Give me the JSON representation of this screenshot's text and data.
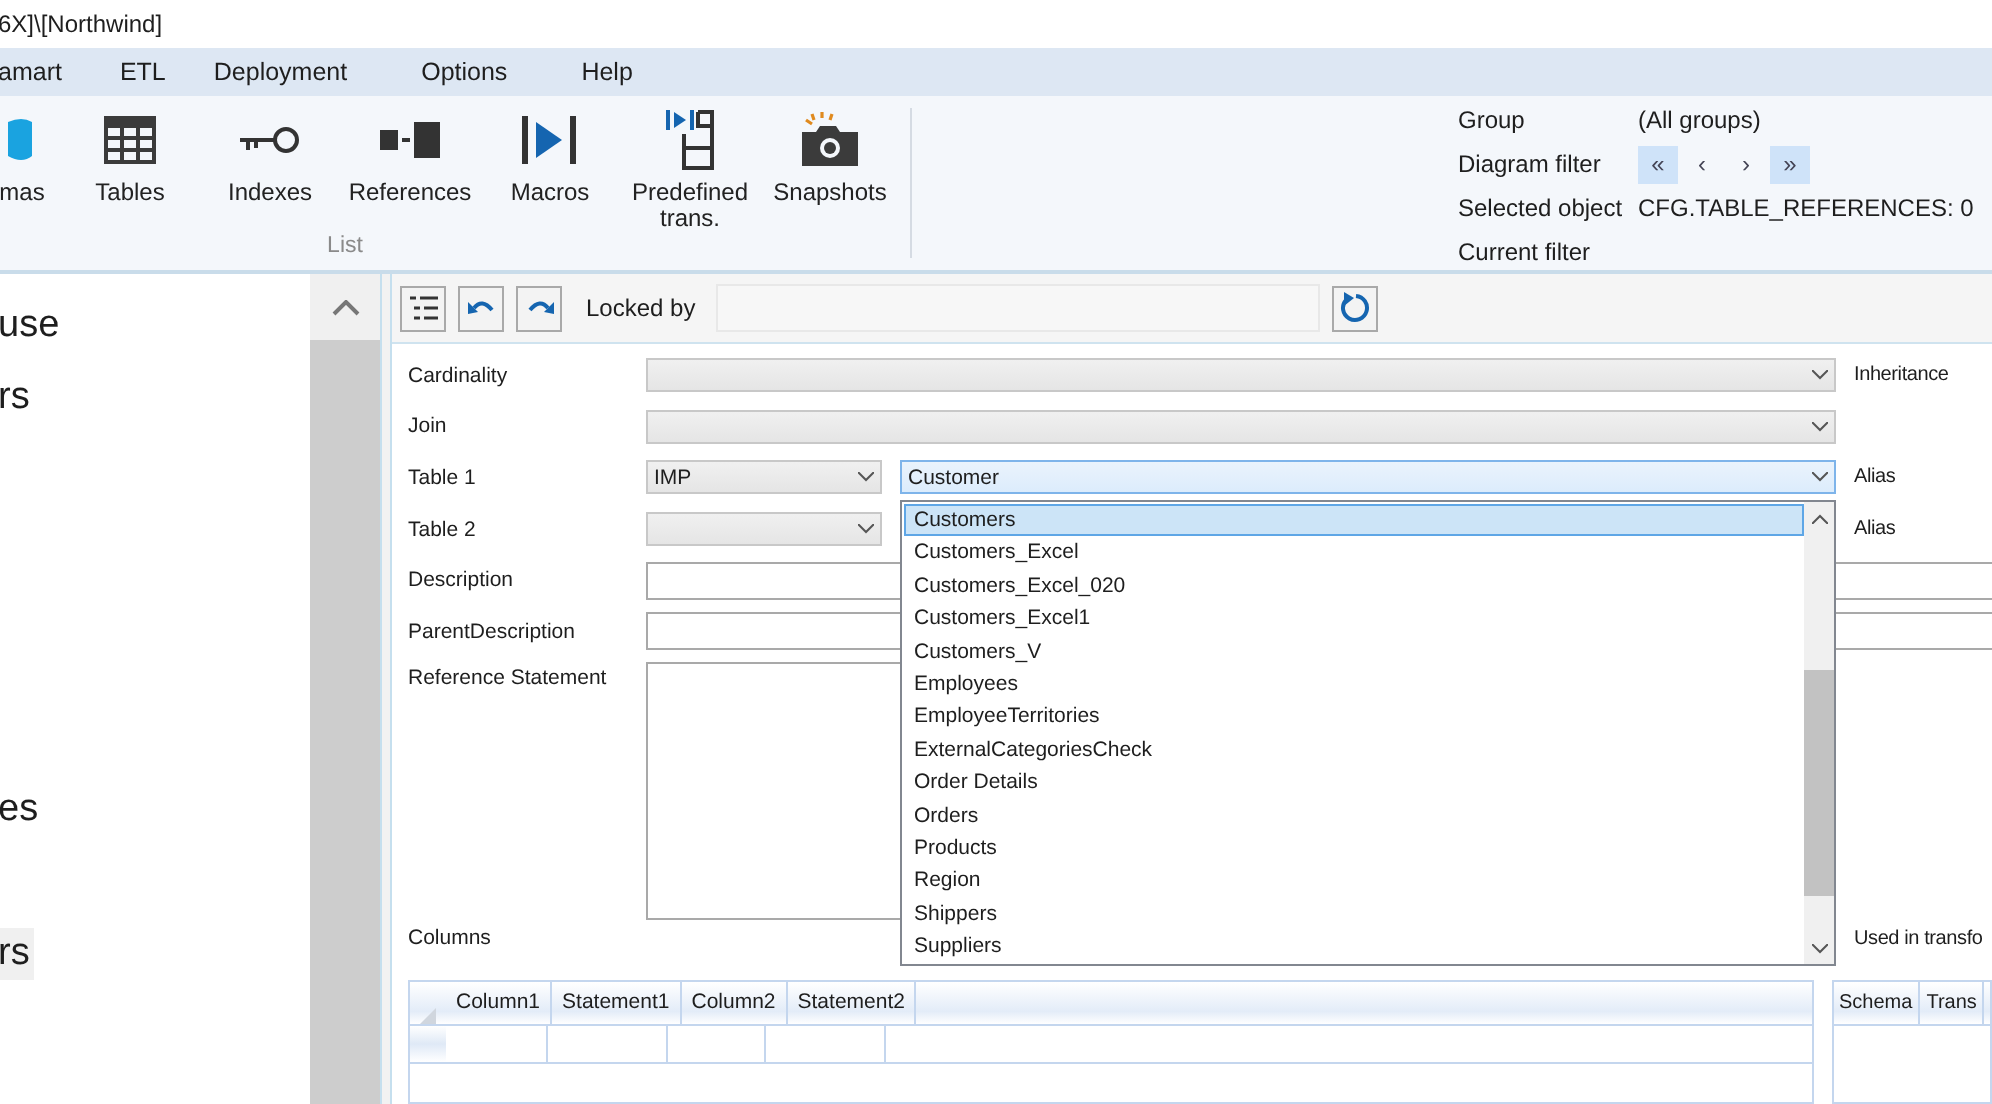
{
  "title": "6X]\\[Northwind]",
  "menu": [
    "amart",
    "ETL",
    "Deployment",
    "Options",
    "Help"
  ],
  "ribbon": {
    "buttons": [
      {
        "kind": "schemas",
        "label": "mas"
      },
      {
        "kind": "tables",
        "label": "Tables"
      },
      {
        "kind": "indexes",
        "label": "Indexes"
      },
      {
        "kind": "references",
        "label": "References"
      },
      {
        "kind": "macros",
        "label": "Macros"
      },
      {
        "kind": "predefined",
        "label": "Predefined trans."
      },
      {
        "kind": "snapshots",
        "label": "Snapshots"
      }
    ],
    "group_label": "List"
  },
  "info": {
    "rows": [
      {
        "label": "Group",
        "value": "(All groups)"
      },
      {
        "label": "Diagram filter",
        "nav": [
          {
            "label": "«",
            "highlighted": true
          },
          {
            "label": "‹",
            "highlighted": false
          },
          {
            "label": "›",
            "highlighted": false
          },
          {
            "label": "»",
            "highlighted": true
          }
        ]
      },
      {
        "label": "Selected object",
        "value": "CFG.TABLE_REFERENCES: 0"
      },
      {
        "label": "Current filter"
      }
    ]
  },
  "left_panel": {
    "top_items": [
      {
        "label": "use",
        "selected": false
      },
      {
        "label": "rs",
        "selected": false
      }
    ],
    "bottom_items": [
      {
        "label": "es",
        "selected": false
      },
      {
        "label": "rs",
        "selected": true
      }
    ]
  },
  "toolbar": {
    "locked_by_label": "Locked by"
  },
  "form": {
    "rows": [
      {
        "kind": "combo",
        "label": "Cardinality",
        "right_label": "Inheritance"
      },
      {
        "kind": "combo",
        "label": "Join"
      },
      {
        "kind": "pair",
        "label": "Table 1",
        "first_value": "IMP",
        "second_value": "Customer",
        "right_label": "Alias"
      },
      {
        "kind": "pair",
        "label": "Table 2",
        "right_label": "Alias"
      },
      {
        "kind": "input",
        "label": "Description"
      },
      {
        "kind": "input",
        "label": "ParentDescription"
      },
      {
        "kind": "textarea",
        "label": "Reference Statement"
      }
    ]
  },
  "dropdown": {
    "items": [
      {
        "label": "Customers",
        "selected": true
      },
      {
        "label": "Customers_Excel",
        "selected": false
      },
      {
        "label": "Customers_Excel_020",
        "selected": false
      },
      {
        "label": "Customers_Excel1",
        "selected": false
      },
      {
        "label": "Customers_V",
        "selected": false
      },
      {
        "label": "Employees",
        "selected": false
      },
      {
        "label": "EmployeeTerritories",
        "selected": false
      },
      {
        "label": "ExternalCategoriesCheck",
        "selected": false
      },
      {
        "label": "Order Details",
        "selected": false
      },
      {
        "label": "Orders",
        "selected": false
      },
      {
        "label": "Products",
        "selected": false
      },
      {
        "label": "Region",
        "selected": false
      },
      {
        "label": "Shippers",
        "selected": false
      },
      {
        "label": "Suppliers",
        "selected": false
      }
    ]
  },
  "columns": {
    "label": "Columns",
    "headers": [
      "Column1",
      "Statement1",
      "Column2",
      "Statement2"
    ]
  },
  "used_in": {
    "label": "Used in transfo",
    "headers": [
      "Schema",
      "Trans"
    ]
  }
}
